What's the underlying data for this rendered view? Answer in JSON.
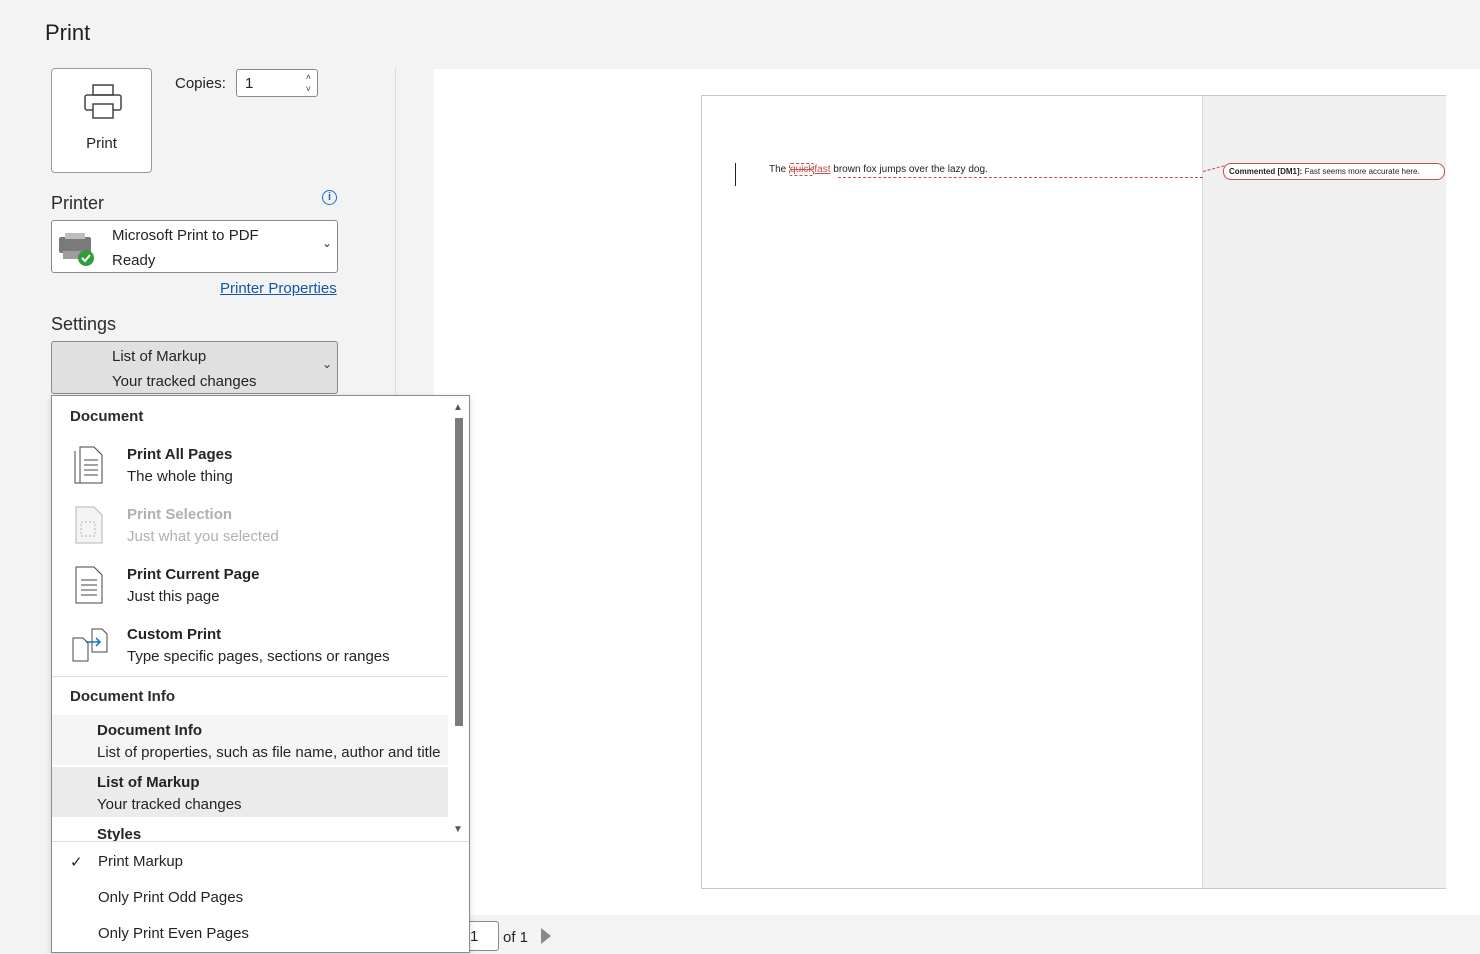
{
  "header": {
    "title": "Print"
  },
  "print_button": {
    "label": "Print",
    "icon": "printer-icon"
  },
  "copies": {
    "label": "Copies:",
    "value": "1"
  },
  "printer": {
    "heading": "Printer",
    "name": "Microsoft Print to PDF",
    "status": "Ready",
    "properties_link": "Printer Properties"
  },
  "settings": {
    "heading": "Settings",
    "selected_title": "List of Markup",
    "selected_sub": "Your tracked changes"
  },
  "dropdown": {
    "doc_heading": "Document",
    "items": [
      {
        "title": "Print All Pages",
        "sub": "The whole thing",
        "icon": "all-pages-icon"
      },
      {
        "title": "Print Selection",
        "sub": "Just what you selected",
        "icon": "selection-icon",
        "disabled": true
      },
      {
        "title": "Print Current Page",
        "sub": "Just this page",
        "icon": "current-page-icon"
      },
      {
        "title": "Custom Print",
        "sub": "Type specific pages, sections or ranges",
        "icon": "custom-print-icon"
      }
    ],
    "info_heading": "Document Info",
    "info_items": [
      {
        "title": "Document Info",
        "sub": "List of properties, such as file name, author and title"
      },
      {
        "title": "List of Markup",
        "sub": "Your tracked changes"
      },
      {
        "title": "Styles",
        "sub": ""
      }
    ],
    "options": [
      {
        "label": "Print Markup",
        "checked": true
      },
      {
        "label": "Only Print Odd Pages",
        "checked": false
      },
      {
        "label": "Only Print Even Pages",
        "checked": false
      }
    ]
  },
  "preview": {
    "text_before": "The ",
    "deleted": "quick",
    "inserted": "fast",
    "text_after": " brown fox jumps over the lazy dog.",
    "comment_label": "Commented [DM1]:",
    "comment_text": " Fast seems more accurate here."
  },
  "page_nav": {
    "current": "1",
    "of_label": "of 1"
  },
  "colors": {
    "accent": "#1356a8",
    "markup": "#c0504d"
  }
}
